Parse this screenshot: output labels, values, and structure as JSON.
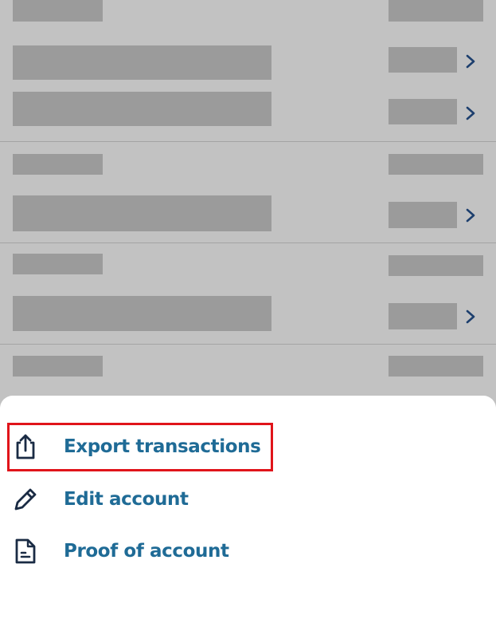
{
  "colors": {
    "overlay_background": "#c2c2c2",
    "placeholder_bar": "#9b9b9b",
    "chevron": "#1d3f6e",
    "action_text": "#1f6b96",
    "icon_dark": "#1a2b44",
    "highlight_border": "#e0141a",
    "sheet_background": "#ffffff"
  },
  "actions": [
    {
      "label": "Export transactions",
      "icon": "share-export-icon",
      "highlighted": true
    },
    {
      "label": "Edit account",
      "icon": "pencil-icon",
      "highlighted": false
    },
    {
      "label": "Proof of account",
      "icon": "document-icon",
      "highlighted": false
    }
  ]
}
